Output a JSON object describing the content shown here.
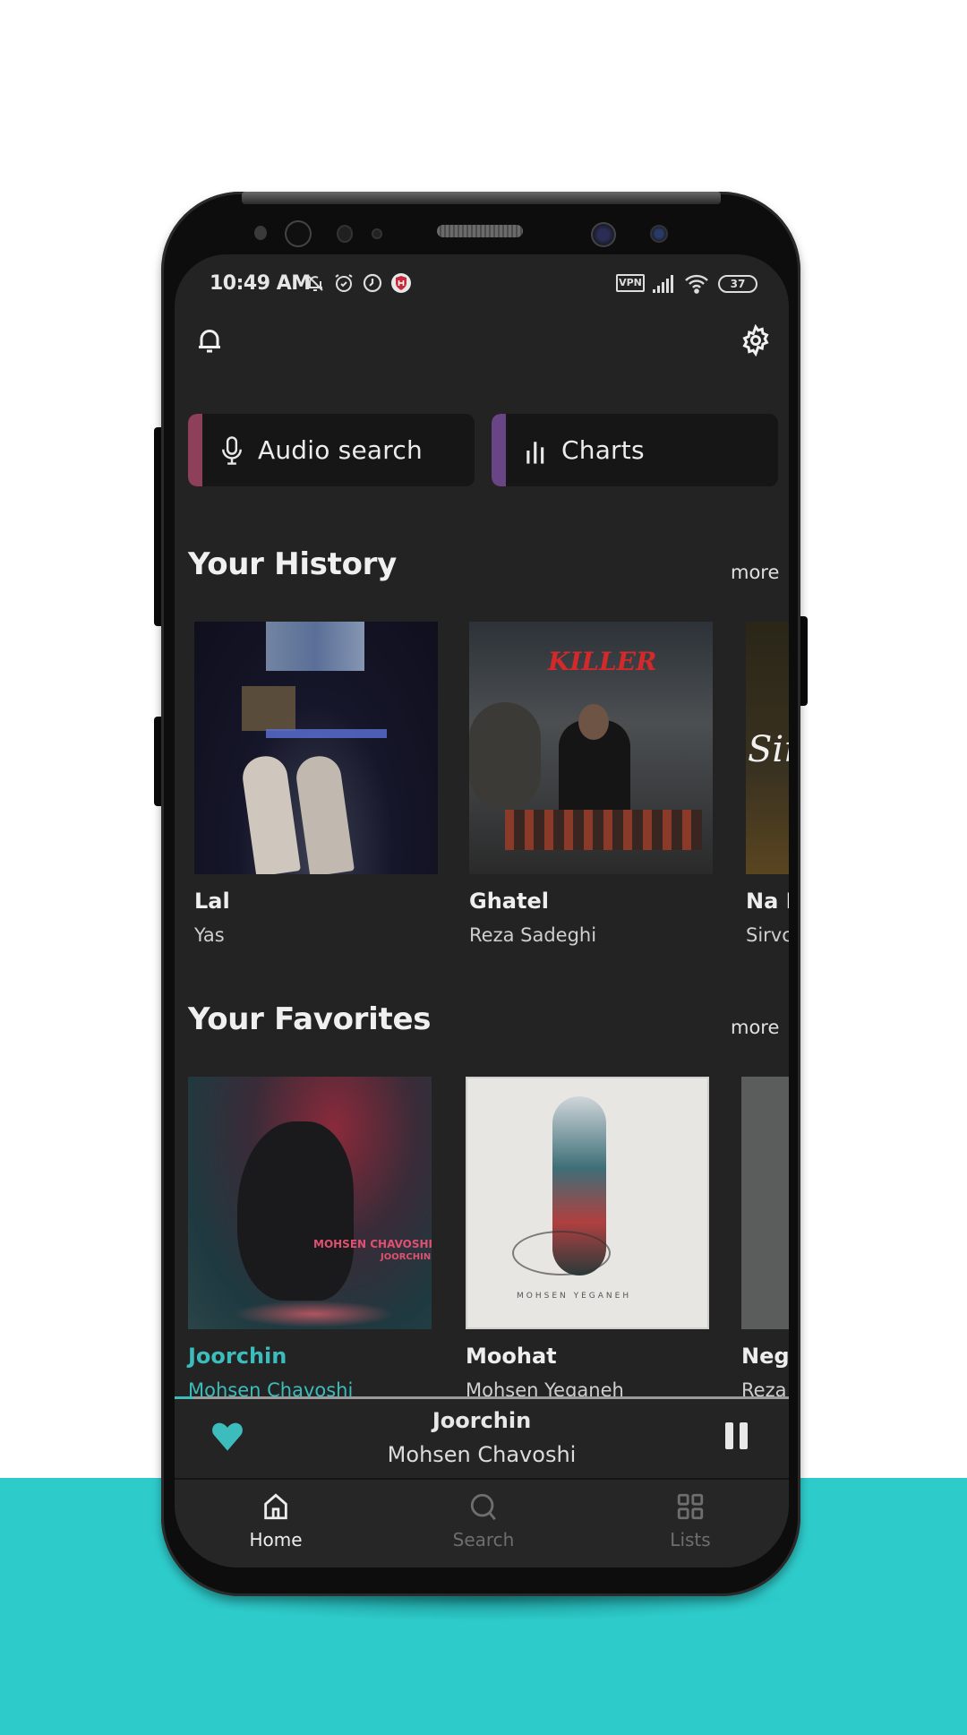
{
  "status_bar": {
    "time": "10:49 AM",
    "left_icons": [
      "bell-off-icon",
      "alarm-icon",
      "timer-icon",
      "shield-app-icon"
    ],
    "vpn": "VPN",
    "battery": "37",
    "right_icons": [
      "vpn-icon",
      "signal-icon",
      "wifi-icon",
      "battery-icon"
    ]
  },
  "toolbar": {
    "notifications_icon": "bell-icon",
    "settings_icon": "gear-icon"
  },
  "quick_actions": [
    {
      "label": "Audio search",
      "icon": "microphone-icon",
      "accent": "#8e3f5a"
    },
    {
      "label": "Charts",
      "icon": "bar-chart-icon",
      "accent": "#6a4585"
    }
  ],
  "history": {
    "title": "Your History",
    "more": "more",
    "items": [
      {
        "title": "Lal",
        "artist": "Yas"
      },
      {
        "title": "Ghatel",
        "artist": "Reza Sadeghi",
        "cover_text": "KILLER"
      },
      {
        "title": "Na I",
        "artist": "Sirvc",
        "cover_text": "Sir"
      }
    ]
  },
  "favorites": {
    "title": "Your Favorites",
    "more": "more",
    "items": [
      {
        "title": "Joorchin",
        "artist": "Mohsen Chavoshi",
        "active": true,
        "cover_text": "MOHSEN CHAVOSHI",
        "cover_subtext": "JOORCHIN"
      },
      {
        "title": "Moohat",
        "artist": "Mohsen Yeganeh",
        "cover_text": "MOHSEN YEGANEH"
      },
      {
        "title": "Neg",
        "artist": "Reza"
      }
    ]
  },
  "now_playing": {
    "title": "Joorchin",
    "artist": "Mohsen Chavoshi",
    "liked": true,
    "state": "playing",
    "progress_fraction": 0.03
  },
  "bottom_nav": [
    {
      "label": "Home",
      "icon": "home-icon",
      "active": true
    },
    {
      "label": "Search",
      "icon": "search-icon",
      "active": false
    },
    {
      "label": "Lists",
      "icon": "grid-icon",
      "active": false
    }
  ],
  "colors": {
    "accent": "#3cbcbc",
    "background_teal": "#2ecbcb",
    "screen_bg": "#232323"
  }
}
